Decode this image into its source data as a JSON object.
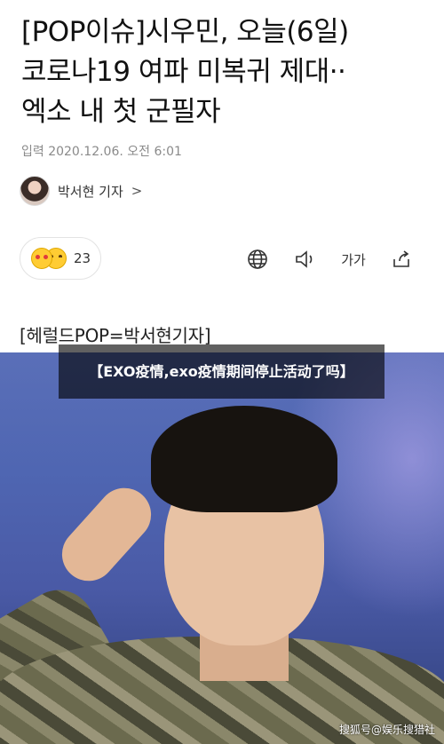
{
  "article": {
    "headline_lines": [
      "[POP이슈]시우민, 오늘(6일)",
      "코로나19 여파 미복귀 제대··",
      "엑소 내 첫 군필자"
    ],
    "published": "입력 2020.12.06. 오전 6:01",
    "reporter": "박서현 기자",
    "reporter_chevron": ">",
    "reaction_count": "23",
    "font_size_label": "가가",
    "photo_caption": "[헤럴드POP=박서현기자]"
  },
  "overlay_title": "【EXO疫情,exo疫情期间停止活动了吗】",
  "watermark": "搜狐号@娱乐搜猎社",
  "icons": [
    "globe-icon",
    "speaker-icon",
    "font-size-icon",
    "share-icon",
    "heart-eyes-emoji",
    "smile-emoji"
  ]
}
